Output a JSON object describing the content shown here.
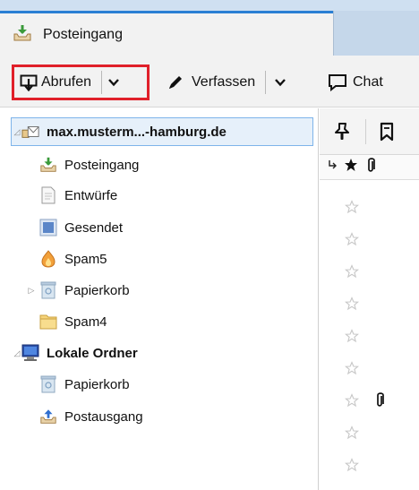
{
  "tab": {
    "label": "Posteingang"
  },
  "toolbar": {
    "get_label": "Abrufen",
    "compose_label": "Verfassen",
    "chat_label": "Chat"
  },
  "folders": [
    {
      "label": "max.musterm...-hamburg.de",
      "icon": "account-icon",
      "bold": true,
      "twisty": "◿"
    },
    {
      "label": "Posteingang",
      "icon": "inbox-icon"
    },
    {
      "label": "Entwürfe",
      "icon": "drafts-icon"
    },
    {
      "label": "Gesendet",
      "icon": "sent-icon"
    },
    {
      "label": "Spam5",
      "icon": "spam-icon"
    },
    {
      "label": "Papierkorb",
      "icon": "trash-icon",
      "twisty": "▷"
    },
    {
      "label": "Spam4",
      "icon": "folder-icon"
    },
    {
      "label": "Lokale Ordner",
      "icon": "local-folders-icon",
      "bold": true,
      "twisty": "◿"
    },
    {
      "label": "Papierkorb",
      "icon": "trash-icon"
    },
    {
      "label": "Postausgang",
      "icon": "outbox-icon"
    }
  ],
  "thread": {
    "columns": [
      "thread",
      "star",
      "attachment"
    ],
    "rows": [
      {
        "starred": false,
        "attachment": false
      },
      {
        "starred": false,
        "attachment": false
      },
      {
        "starred": false,
        "attachment": false
      },
      {
        "starred": false,
        "attachment": false
      },
      {
        "starred": false,
        "attachment": false
      },
      {
        "starred": false,
        "attachment": false
      },
      {
        "starred": false,
        "attachment": true
      },
      {
        "starred": false,
        "attachment": false
      },
      {
        "starred": false,
        "attachment": false
      }
    ]
  },
  "colors": {
    "accent": "#2a7fd4",
    "highlight_border": "#e0202a",
    "tabbar": "#cfe0f1"
  }
}
